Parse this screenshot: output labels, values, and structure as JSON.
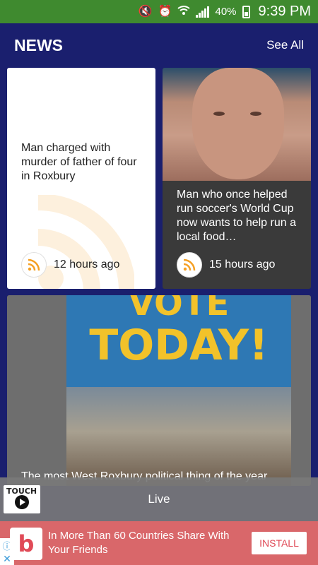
{
  "status_bar": {
    "icons": [
      "mute-icon",
      "alarm-icon",
      "wifi-icon",
      "signal-icon"
    ],
    "battery_percent": "40%",
    "time": "9:39 PM"
  },
  "header": {
    "title": "NEWS",
    "see_all_label": "See All"
  },
  "cards": [
    {
      "headline": "Man charged with murder of father of four in Roxbury",
      "time": "12 hours ago"
    },
    {
      "headline": "Man who once helped run soccer's World Cup now wants to help run a local food…",
      "time": "15 hours ago"
    },
    {
      "headline": "The most West Roxbury political thing of the year",
      "poster_line1": "VOTE",
      "poster_line2": "TODAY!"
    }
  ],
  "player": {
    "logo_text": "TOUCH",
    "label": "Live"
  },
  "ad": {
    "icon_letter": "b",
    "text": "In More Than 60 Countries Share With Your Friends",
    "install_label": "INSTALL"
  },
  "colors": {
    "status_bar": "#3f8a2f",
    "background": "#1a1f6e",
    "rss_orange": "#f5a023",
    "ad_background": "#d9676a"
  }
}
